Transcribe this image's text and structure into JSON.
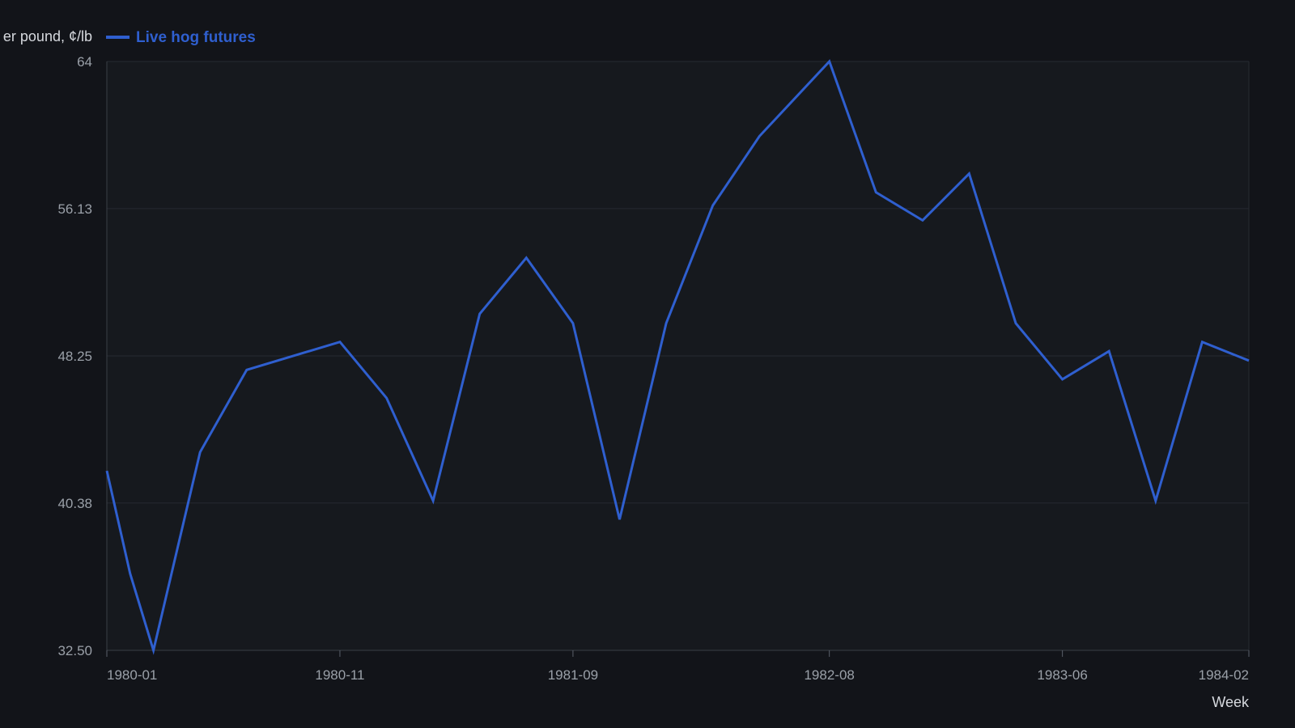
{
  "chart_data": {
    "type": "line",
    "title": "",
    "xlabel": "Week",
    "ylabel": "er pound, ¢/lb",
    "ylim": [
      32.5,
      64
    ],
    "yticks": [
      "64",
      "56.13",
      "48.25",
      "40.38",
      "32.50"
    ],
    "xticks": [
      "1980-01",
      "1980-11",
      "1981-09",
      "1982-08",
      "1983-06",
      "1984-02"
    ],
    "grid": true,
    "legend_position": "top-left",
    "colors": {
      "background": "#121419",
      "plot_background": "#16191e",
      "grid": "#262a31",
      "series": "#2f5fcf"
    },
    "series": [
      {
        "name": "Live hog futures",
        "x": [
          "1980-01",
          "1980-02",
          "1980-03",
          "1980-05",
          "1980-07",
          "1980-11",
          "1981-01",
          "1981-03",
          "1981-05",
          "1981-07",
          "1981-09",
          "1981-11",
          "1982-01",
          "1982-03",
          "1982-05",
          "1982-08",
          "1982-10",
          "1982-12",
          "1983-02",
          "1983-04",
          "1983-06",
          "1983-08",
          "1983-10",
          "1983-12",
          "1984-02"
        ],
        "values": [
          42.1,
          36.6,
          32.5,
          43.1,
          47.5,
          49.0,
          46.0,
          40.5,
          50.5,
          53.5,
          50.0,
          39.5,
          50.0,
          56.3,
          60.0,
          64.0,
          57.0,
          55.5,
          58.0,
          50.0,
          47.0,
          48.5,
          40.5,
          49.0,
          48.0
        ]
      }
    ]
  }
}
